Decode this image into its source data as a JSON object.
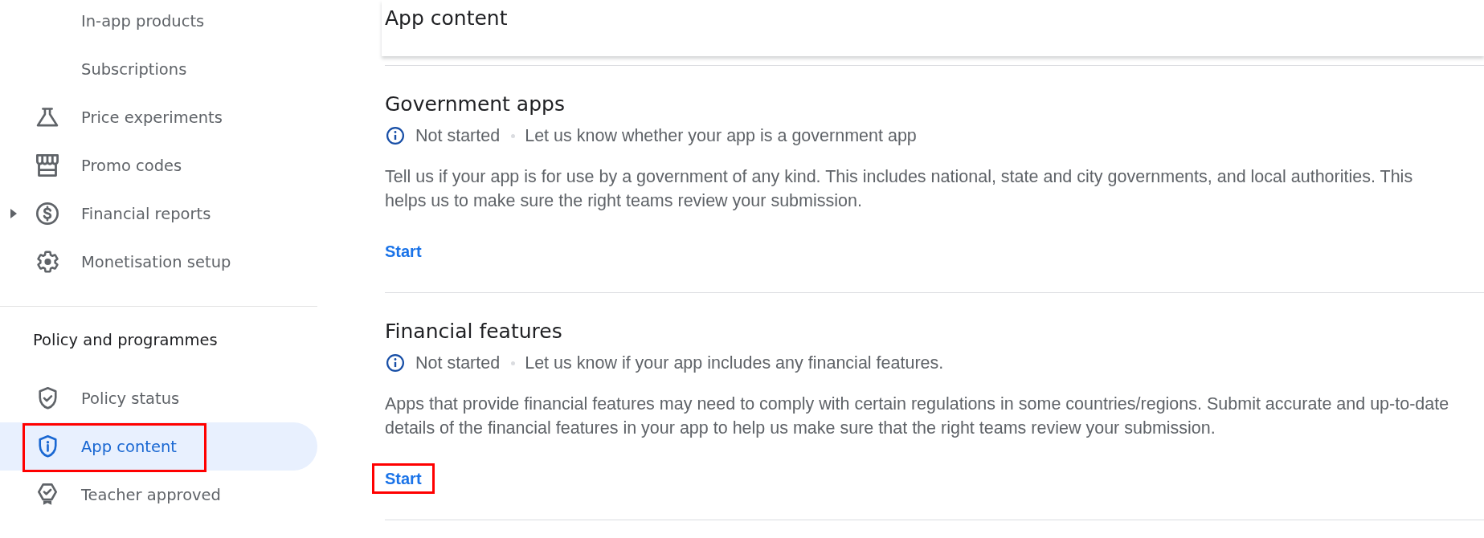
{
  "sidebar": {
    "groups": [
      {
        "items": [
          {
            "label": "In-app products",
            "kind": "subitem",
            "selected": false,
            "highlighted": false
          },
          {
            "label": "Subscriptions",
            "kind": "subitem",
            "selected": false,
            "highlighted": false
          },
          {
            "label": "Price experiments",
            "kind": "item",
            "selected": false,
            "highlighted": false
          },
          {
            "label": "Promo codes",
            "kind": "item",
            "selected": false,
            "highlighted": false
          },
          {
            "label": "Financial reports",
            "kind": "item",
            "selected": false,
            "highlighted": false,
            "expanded": false
          },
          {
            "label": "Monetisation setup",
            "kind": "item",
            "selected": false,
            "highlighted": false
          }
        ]
      },
      {
        "heading": "Policy and programmes",
        "items": [
          {
            "label": "Policy status",
            "kind": "item",
            "selected": false,
            "highlighted": false
          },
          {
            "label": "App content",
            "kind": "item",
            "selected": true,
            "highlighted": true
          },
          {
            "label": "Teacher approved",
            "kind": "item",
            "selected": false,
            "highlighted": false
          }
        ]
      }
    ]
  },
  "main": {
    "title": "App content",
    "sections": [
      {
        "title": "Government apps",
        "status": "Not started",
        "summary": "Let us know whether your app is a government app",
        "description": "Tell us if your app is for use by a government of any kind. This includes national, state and city governments, and local authorities. This helps us to make sure the right teams review your submission.",
        "action": {
          "label": "Start",
          "highlighted": false
        }
      },
      {
        "title": "Financial features",
        "status": "Not started",
        "summary": "Let us know if your app includes any financial features.",
        "description": "Apps that provide financial features may need to comply with certain regulations in some countries/regions. Submit accurate and up-to-date details of the financial features in your app to help us make sure that the right teams review your submission.",
        "action": {
          "label": "Start",
          "highlighted": true
        }
      }
    ]
  }
}
